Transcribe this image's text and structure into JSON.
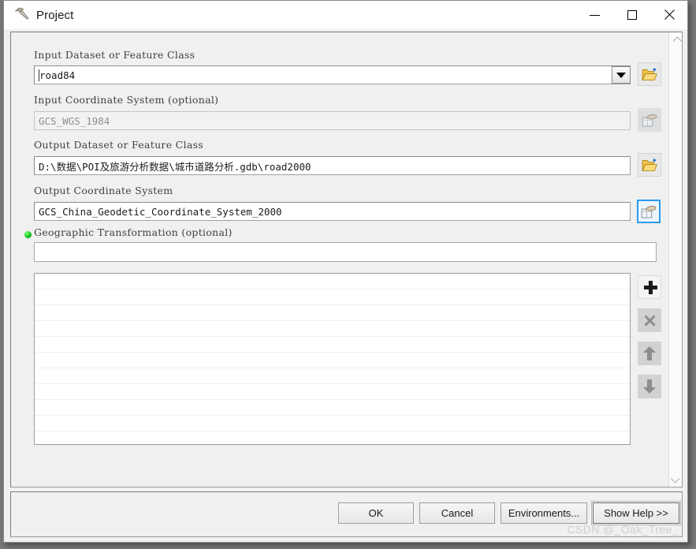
{
  "window": {
    "title": "Project",
    "icon": "hammer-tool-icon",
    "controls": {
      "minimize": "minimize-icon",
      "maximize": "maximize-icon",
      "close": "close-icon"
    }
  },
  "form": {
    "input_dataset": {
      "label": "Input Dataset or Feature Class",
      "value": "road84",
      "dropdown_icon": "triangle-down-icon",
      "browse_icon": "open-folder-icon"
    },
    "input_coordinate_system": {
      "label": "Input Coordinate System (optional)",
      "value": "GCS_WGS_1984",
      "disabled": true,
      "browse_icon": "spatial-reference-icon"
    },
    "output_dataset": {
      "label": "Output Dataset or Feature Class",
      "value": "D:\\数据\\POI及旅游分析数据\\城市道路分析.gdb\\road2000",
      "browse_icon": "open-folder-icon"
    },
    "output_coordinate_system": {
      "label": "Output Coordinate System",
      "value": "GCS_China_Geodetic_Coordinate_System_2000",
      "browse_icon": "spatial-reference-icon",
      "focused": true
    },
    "geographic_transformation": {
      "label": "Geographic Transformation (optional)",
      "value": "",
      "placeholder": "",
      "required_marker": "green-dot-icon",
      "chevron_icon": "chevron-down-icon"
    },
    "transformation_list": {
      "rows": [
        "",
        "",
        "",
        "",
        "",
        "",
        "",
        "",
        "",
        "",
        ""
      ],
      "buttons": [
        {
          "name": "add",
          "icon": "plus-icon",
          "enabled": true
        },
        {
          "name": "remove",
          "icon": "cross-icon",
          "enabled": false
        },
        {
          "name": "move-up",
          "icon": "arrow-up-icon",
          "enabled": false
        },
        {
          "name": "move-down",
          "icon": "arrow-down-icon",
          "enabled": false
        }
      ]
    }
  },
  "scrollbar": {
    "up_icon": "chevron-up-icon",
    "down_icon": "chevron-down-icon"
  },
  "footer": {
    "buttons": [
      {
        "label": "OK",
        "default": false
      },
      {
        "label": "Cancel",
        "default": false
      },
      {
        "label": "Environments...",
        "default": false
      },
      {
        "label": "Show Help >>",
        "default": true
      }
    ],
    "watermark": "CSDN @_Oak_Tree_"
  },
  "colors": {
    "dialog_bg": "#f0f0f0",
    "titlebar_bg": "#ffffff",
    "focus_blue": "#2d9cee",
    "required_green": "#13c413",
    "folder_yellow": "#f3c44a",
    "watermark_grey": "#cfcfcf"
  }
}
